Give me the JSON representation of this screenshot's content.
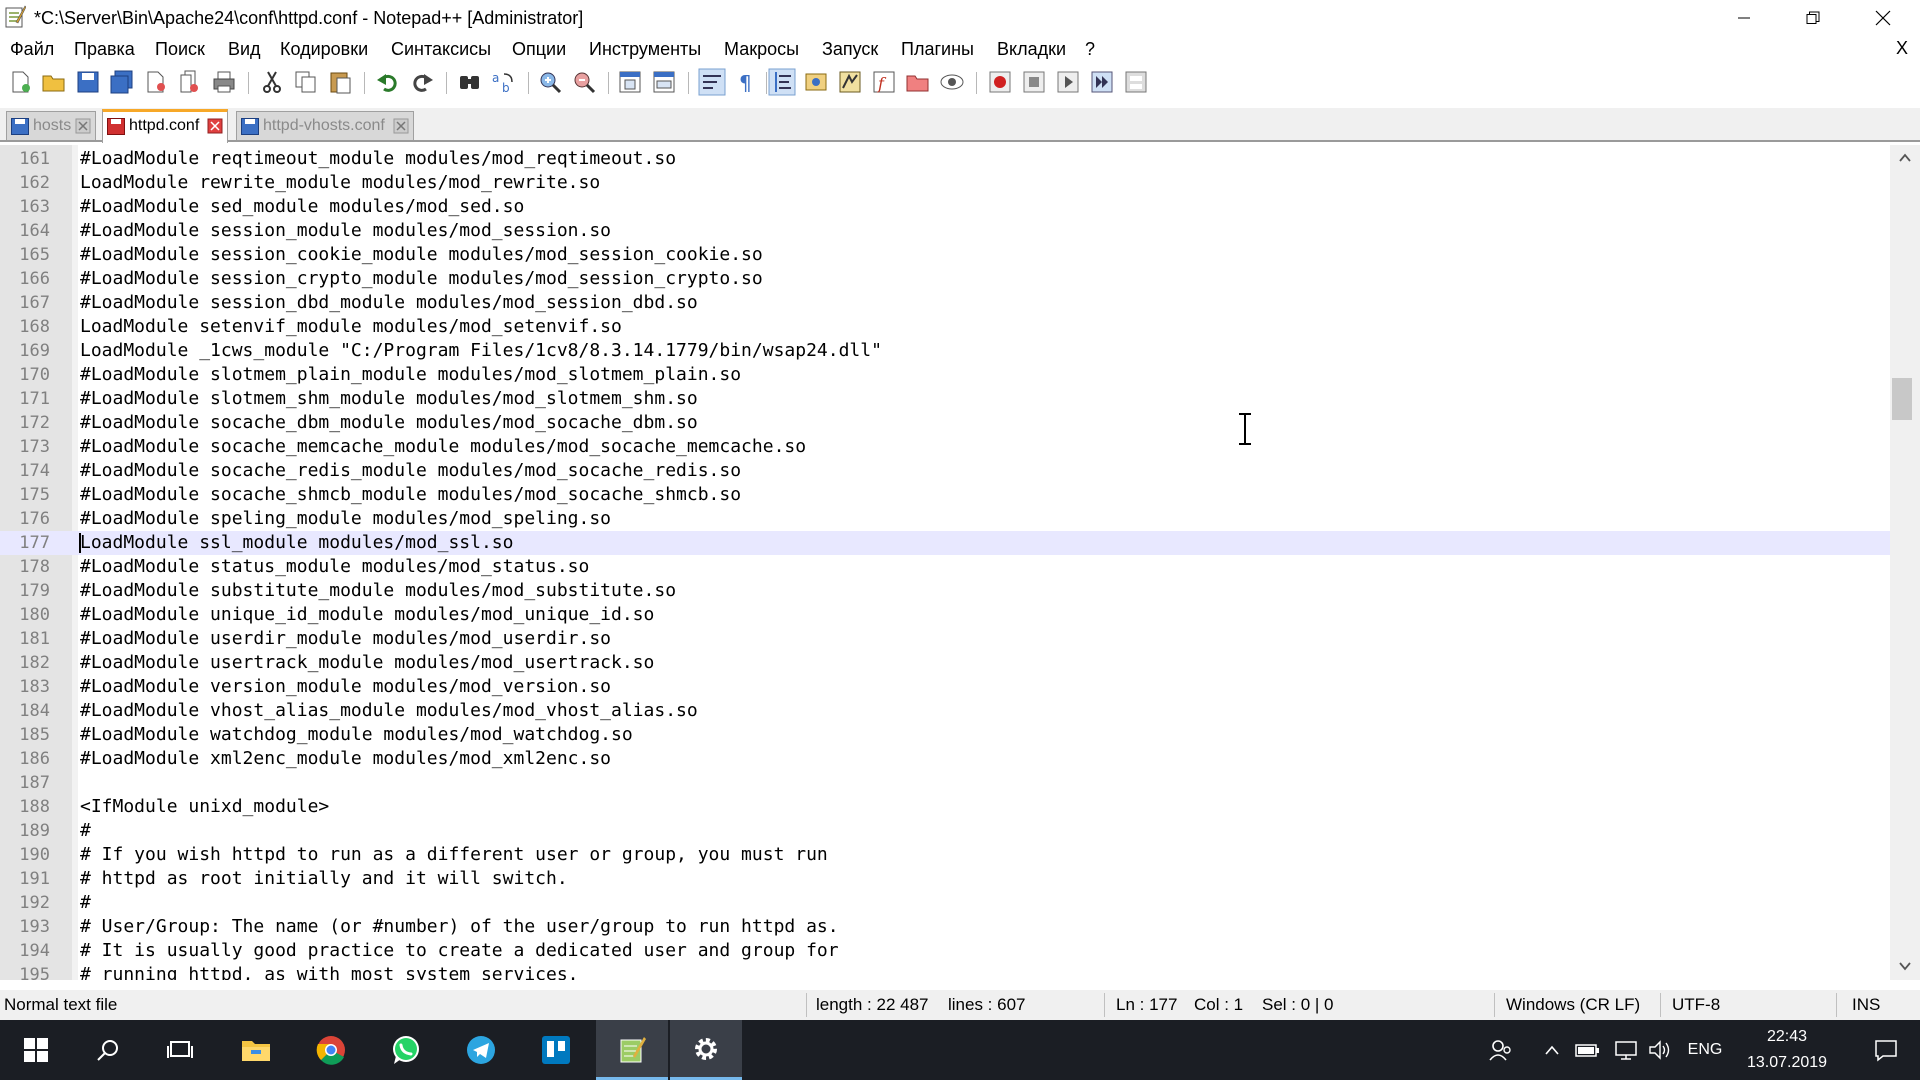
{
  "window": {
    "title": "*C:\\Server\\Bin\\Apache24\\conf\\httpd.conf - Notepad++ [Administrator]"
  },
  "menu": {
    "items": [
      "Файл",
      "Правка",
      "Поиск",
      "Вид",
      "Кодировки",
      "Синтаксисы",
      "Опции",
      "Инструменты",
      "Макросы",
      "Запуск",
      "Плагины",
      "Вкладки",
      "?"
    ],
    "close_label": "X"
  },
  "tabs": [
    {
      "label": "hosts",
      "active": false
    },
    {
      "label": "httpd.conf",
      "active": true
    },
    {
      "label": "httpd-vhosts.conf",
      "active": false
    }
  ],
  "editor": {
    "current_line": 177,
    "lines": [
      {
        "n": "161",
        "text": "#LoadModule reqtimeout_module modules/mod_reqtimeout.so"
      },
      {
        "n": "162",
        "text": "LoadModule rewrite_module modules/mod_rewrite.so"
      },
      {
        "n": "163",
        "text": "#LoadModule sed_module modules/mod_sed.so"
      },
      {
        "n": "164",
        "text": "#LoadModule session_module modules/mod_session.so"
      },
      {
        "n": "165",
        "text": "#LoadModule session_cookie_module modules/mod_session_cookie.so"
      },
      {
        "n": "166",
        "text": "#LoadModule session_crypto_module modules/mod_session_crypto.so"
      },
      {
        "n": "167",
        "text": "#LoadModule session_dbd_module modules/mod_session_dbd.so"
      },
      {
        "n": "168",
        "text": "LoadModule setenvif_module modules/mod_setenvif.so"
      },
      {
        "n": "169",
        "text": "LoadModule _1cws_module \"C:/Program Files/1cv8/8.3.14.1779/bin/wsap24.dll\""
      },
      {
        "n": "170",
        "text": "#LoadModule slotmem_plain_module modules/mod_slotmem_plain.so"
      },
      {
        "n": "171",
        "text": "#LoadModule slotmem_shm_module modules/mod_slotmem_shm.so"
      },
      {
        "n": "172",
        "text": "#LoadModule socache_dbm_module modules/mod_socache_dbm.so"
      },
      {
        "n": "173",
        "text": "#LoadModule socache_memcache_module modules/mod_socache_memcache.so"
      },
      {
        "n": "174",
        "text": "#LoadModule socache_redis_module modules/mod_socache_redis.so"
      },
      {
        "n": "175",
        "text": "#LoadModule socache_shmcb_module modules/mod_socache_shmcb.so"
      },
      {
        "n": "176",
        "text": "#LoadModule speling_module modules/mod_speling.so"
      },
      {
        "n": "177",
        "text": "LoadModule ssl_module modules/mod_ssl.so"
      },
      {
        "n": "178",
        "text": "#LoadModule status_module modules/mod_status.so"
      },
      {
        "n": "179",
        "text": "#LoadModule substitute_module modules/mod_substitute.so"
      },
      {
        "n": "180",
        "text": "#LoadModule unique_id_module modules/mod_unique_id.so"
      },
      {
        "n": "181",
        "text": "#LoadModule userdir_module modules/mod_userdir.so"
      },
      {
        "n": "182",
        "text": "#LoadModule usertrack_module modules/mod_usertrack.so"
      },
      {
        "n": "183",
        "text": "#LoadModule version_module modules/mod_version.so"
      },
      {
        "n": "184",
        "text": "#LoadModule vhost_alias_module modules/mod_vhost_alias.so"
      },
      {
        "n": "185",
        "text": "#LoadModule watchdog_module modules/mod_watchdog.so"
      },
      {
        "n": "186",
        "text": "#LoadModule xml2enc_module modules/mod_xml2enc.so"
      },
      {
        "n": "187",
        "text": ""
      },
      {
        "n": "188",
        "text": "<IfModule unixd_module>"
      },
      {
        "n": "189",
        "text": "#"
      },
      {
        "n": "190",
        "text": "# If you wish httpd to run as a different user or group, you must run"
      },
      {
        "n": "191",
        "text": "# httpd as root initially and it will switch."
      },
      {
        "n": "192",
        "text": "#"
      },
      {
        "n": "193",
        "text": "# User/Group: The name (or #number) of the user/group to run httpd as."
      },
      {
        "n": "194",
        "text": "# It is usually good practice to create a dedicated user and group for"
      },
      {
        "n": "195",
        "text": "# running httpd, as with most system services."
      }
    ]
  },
  "status": {
    "file_type": "Normal text file",
    "length": "length : 22 487",
    "lines": "lines : 607",
    "ln": "Ln : 177",
    "col": "Col : 1",
    "sel": "Sel : 0 | 0",
    "eol": "Windows (CR LF)",
    "encoding": "UTF-8",
    "mode": "INS"
  },
  "taskbar": {
    "apps": [
      "start-icon",
      "search-icon",
      "task-view-icon",
      "file-explorer-icon",
      "chrome-icon",
      "whatsapp-icon",
      "telegram-icon",
      "trello-icon",
      "notepadpp-icon",
      "settings-icon"
    ],
    "language": "ENG",
    "time": "22:43",
    "date": "13.07.2019"
  },
  "colors": {
    "accent_tab": "#f7a828",
    "current_line": "#e8e8ff",
    "taskbar": "#1b1e24"
  }
}
